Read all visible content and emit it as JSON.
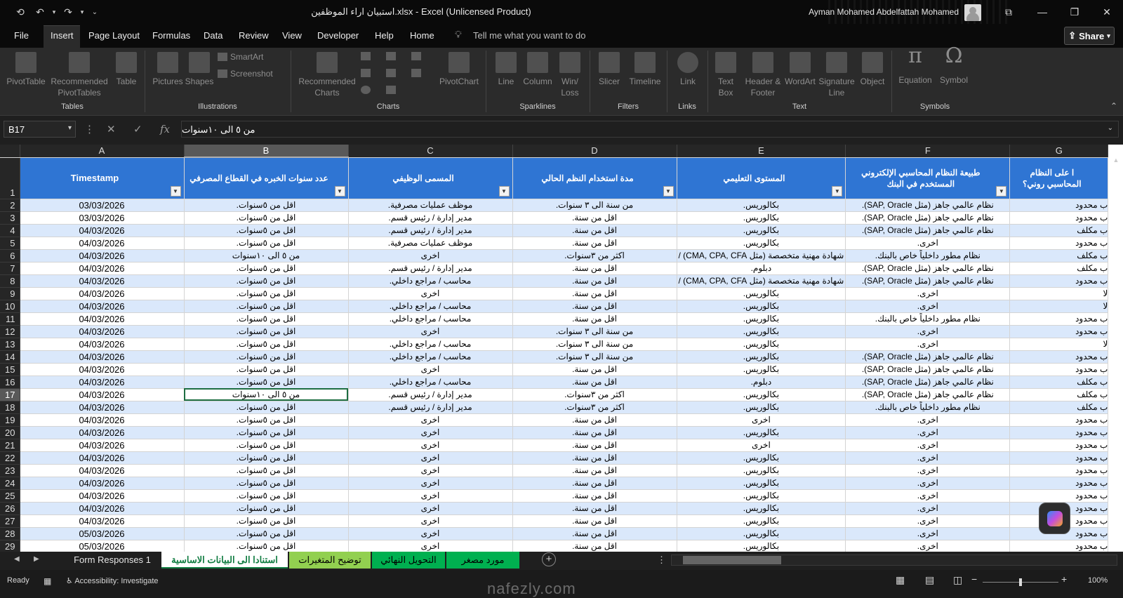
{
  "window": {
    "title": "استبيان اراء الموظفين.xlsx  -  Excel (Unlicensed Product)",
    "user": "Ayman Mohamed Abdelfattah Mohamed"
  },
  "menu": {
    "items": [
      "File",
      "Insert",
      "Page Layout",
      "Formulas",
      "Data",
      "Review",
      "View",
      "Developer",
      "Help",
      "Home"
    ],
    "tell_me": "Tell me what you want to do",
    "share": "Share"
  },
  "ribbon": {
    "tables": {
      "label": "Tables",
      "pivot": "PivotTable",
      "recommended": "Recommended PivotTables",
      "table": "Table"
    },
    "illustrations": {
      "label": "Illustrations",
      "pictures": "Pictures",
      "shapes": "Shapes",
      "smartart": "SmartArt",
      "screenshot": "Screenshot"
    },
    "charts": {
      "label": "Charts",
      "recommended": "Recommended Charts",
      "pivotchart": "PivotChart"
    },
    "sparklines": {
      "label": "Sparklines",
      "line": "Line",
      "column": "Column",
      "winloss": "Win/ Loss"
    },
    "filters": {
      "label": "Filters",
      "slicer": "Slicer",
      "timeline": "Timeline"
    },
    "links": {
      "label": "Links",
      "link": "Link"
    },
    "text": {
      "label": "Text",
      "textbox": "Text Box",
      "header": "Header & Footer",
      "wordart": "WordArt",
      "signature": "Signature Line",
      "object": "Object"
    },
    "symbols": {
      "label": "Symbols",
      "equation": "Equation",
      "symbol": "Symbol"
    }
  },
  "formula_bar": {
    "name_box": "B17",
    "value": "من ٥ الى ١٠سنوات"
  },
  "columns": [
    "A",
    "B",
    "C",
    "D",
    "E",
    "F",
    "G"
  ],
  "headers": {
    "A": "Timestamp",
    "B": "عدد سنوات الخبره في القطاع المصرفي",
    "C": "المسمى الوظيفي",
    "D": "مدة استخدام النظم الحالي",
    "E": "المستوى التعليمي",
    "F": "طبيعة النظام المحاسبي الإلكتروني المستخدم في البنك",
    "G": "ا على النظام المحاسبي روني؟"
  },
  "rows": [
    {
      "n": "2",
      "a": "03/03/2026",
      "b": "اقل من ٥سنوات.",
      "c": "موظف عمليات مصرفية.",
      "d": "من سنة الى ٣ سنوات.",
      "e": "بكالوريس.",
      "f": "نظام عالمي جاهز (مثل SAP, Oracle).",
      "g": "ب محدود"
    },
    {
      "n": "3",
      "a": "03/03/2026",
      "b": "اقل من ٥سنوات.",
      "c": "مدير إدارة / رئيس قسم.",
      "d": "اقل من سنة.",
      "e": "بكالوريس.",
      "f": "نظام عالمي جاهز (مثل SAP, Oracle).",
      "g": "ب محدود"
    },
    {
      "n": "4",
      "a": "04/03/2026",
      "b": "اقل من ٥سنوات.",
      "c": "مدير إدارة / رئيس قسم.",
      "d": "اقل من سنة.",
      "e": "بكالوريس.",
      "f": "نظام عالمي جاهز (مثل SAP, Oracle).",
      "g": "ب مكلف"
    },
    {
      "n": "5",
      "a": "04/03/2026",
      "b": "اقل من ٥سنوات.",
      "c": "موظف عمليات مصرفية.",
      "d": "اقل من سنة.",
      "e": "بكالوريس.",
      "f": "اخرى.",
      "g": "ب محدود"
    },
    {
      "n": "6",
      "a": "04/03/2026",
      "b": "من ٥ الى ١٠سنوات",
      "c": "اخرى",
      "d": "اكثر من ٣سنوات.",
      "e": "شهادة مهنية متخصصة (مثل CMA, CPA, CFA) /",
      "f": "نظام مطور داخلياً خاص بالبنك.",
      "g": "ب مكلف"
    },
    {
      "n": "7",
      "a": "04/03/2026",
      "b": "اقل من ٥سنوات.",
      "c": "مدير إدارة / رئيس قسم.",
      "d": "اقل من سنة.",
      "e": "دبلوم.",
      "f": "نظام عالمي جاهز (مثل SAP, Oracle).",
      "g": "ب مكلف"
    },
    {
      "n": "8",
      "a": "04/03/2026",
      "b": "اقل من ٥سنوات.",
      "c": "محاسب / مراجع داخلي.",
      "d": "اقل من سنة.",
      "e": "شهادة مهنية متخصصة (مثل CMA, CPA, CFA) /",
      "f": "نظام عالمي جاهز (مثل SAP, Oracle).",
      "g": "ب محدود"
    },
    {
      "n": "9",
      "a": "04/03/2026",
      "b": "اقل من ٥سنوات.",
      "c": "اخرى",
      "d": "اقل من سنة.",
      "e": "بكالوريس.",
      "f": "اخرى.",
      "g": "لا"
    },
    {
      "n": "10",
      "a": "04/03/2026",
      "b": "اقل من ٥سنوات.",
      "c": "محاسب / مراجع داخلي.",
      "d": "اقل من سنة.",
      "e": "بكالوريس.",
      "f": "اخرى.",
      "g": "لا"
    },
    {
      "n": "11",
      "a": "04/03/2026",
      "b": "اقل من ٥سنوات.",
      "c": "محاسب / مراجع داخلي.",
      "d": "اقل من سنة.",
      "e": "بكالوريس.",
      "f": "نظام مطور داخلياً خاص بالبنك.",
      "g": "ب محدود"
    },
    {
      "n": "12",
      "a": "04/03/2026",
      "b": "اقل من ٥سنوات.",
      "c": "اخرى",
      "d": "من سنة الى ٣ سنوات.",
      "e": "بكالوريس.",
      "f": "اخرى.",
      "g": "ب محدود"
    },
    {
      "n": "13",
      "a": "04/03/2026",
      "b": "اقل من ٥سنوات.",
      "c": "محاسب / مراجع داخلي.",
      "d": "من سنة الى ٣ سنوات.",
      "e": "بكالوريس.",
      "f": "اخرى.",
      "g": "لا"
    },
    {
      "n": "14",
      "a": "04/03/2026",
      "b": "اقل من ٥سنوات.",
      "c": "محاسب / مراجع داخلي.",
      "d": "من سنة الى ٣ سنوات.",
      "e": "بكالوريس.",
      "f": "نظام عالمي جاهز (مثل SAP, Oracle).",
      "g": "ب محدود"
    },
    {
      "n": "15",
      "a": "04/03/2026",
      "b": "اقل من ٥سنوات.",
      "c": "اخرى",
      "d": "اقل من سنة.",
      "e": "بكالوريس.",
      "f": "نظام عالمي جاهز (مثل SAP, Oracle).",
      "g": "ب محدود"
    },
    {
      "n": "16",
      "a": "04/03/2026",
      "b": "اقل من ٥سنوات.",
      "c": "محاسب / مراجع داخلي.",
      "d": "اقل من سنة.",
      "e": "دبلوم.",
      "f": "نظام عالمي جاهز (مثل SAP, Oracle).",
      "g": "ب مكلف"
    },
    {
      "n": "17",
      "a": "04/03/2026",
      "b": "من ٥ الى ١٠سنوات",
      "c": "مدير إدارة / رئيس قسم.",
      "d": "اكثر من ٣سنوات.",
      "e": "بكالوريس.",
      "f": "نظام عالمي جاهز (مثل SAP, Oracle).",
      "g": "ب مكلف"
    },
    {
      "n": "18",
      "a": "04/03/2026",
      "b": "اقل من ٥سنوات.",
      "c": "مدير إدارة / رئيس قسم.",
      "d": "اكثر من ٣سنوات.",
      "e": "بكالوريس.",
      "f": "نظام مطور داخلياً خاص بالبنك.",
      "g": "ب مكلف"
    },
    {
      "n": "19",
      "a": "04/03/2026",
      "b": "اقل من ٥سنوات.",
      "c": "اخرى",
      "d": "اقل من سنة.",
      "e": "اخرى",
      "f": "اخرى.",
      "g": "ب محدود"
    },
    {
      "n": "20",
      "a": "04/03/2026",
      "b": "اقل من ٥سنوات.",
      "c": "اخرى",
      "d": "اقل من سنة.",
      "e": "بكالوريس.",
      "f": "اخرى.",
      "g": "ب محدود"
    },
    {
      "n": "21",
      "a": "04/03/2026",
      "b": "اقل من ٥سنوات.",
      "c": "اخرى",
      "d": "اقل من سنة.",
      "e": "اخرى",
      "f": "اخرى.",
      "g": "ب محدود"
    },
    {
      "n": "22",
      "a": "04/03/2026",
      "b": "اقل من ٥سنوات.",
      "c": "اخرى",
      "d": "اقل من سنة.",
      "e": "بكالوريس.",
      "f": "اخرى.",
      "g": "ب محدود"
    },
    {
      "n": "23",
      "a": "04/03/2026",
      "b": "اقل من ٥سنوات.",
      "c": "اخرى",
      "d": "اقل من سنة.",
      "e": "بكالوريس.",
      "f": "اخرى.",
      "g": "ب محدود"
    },
    {
      "n": "24",
      "a": "04/03/2026",
      "b": "اقل من ٥سنوات.",
      "c": "اخرى",
      "d": "اقل من سنة.",
      "e": "بكالوريس.",
      "f": "اخرى.",
      "g": "ب محدود"
    },
    {
      "n": "25",
      "a": "04/03/2026",
      "b": "اقل من ٥سنوات.",
      "c": "اخرى",
      "d": "اقل من سنة.",
      "e": "بكالوريس.",
      "f": "اخرى.",
      "g": "ب محدود"
    },
    {
      "n": "26",
      "a": "04/03/2026",
      "b": "اقل من ٥سنوات.",
      "c": "اخرى",
      "d": "اقل من سنة.",
      "e": "بكالوريس.",
      "f": "اخرى.",
      "g": "ب محدود"
    },
    {
      "n": "27",
      "a": "04/03/2026",
      "b": "اقل من ٥سنوات.",
      "c": "اخرى",
      "d": "اقل من سنة.",
      "e": "بكالوريس.",
      "f": "اخرى.",
      "g": "ب محدود"
    },
    {
      "n": "28",
      "a": "05/03/2026",
      "b": "اقل من ٥سنوات.",
      "c": "اخرى",
      "d": "اقل من سنة.",
      "e": "بكالوريس.",
      "f": "اخرى.",
      "g": "ب محدود"
    },
    {
      "n": "29",
      "a": "05/03/2026",
      "b": "اقل من ٥سنوات.",
      "c": "اخرى",
      "d": "اقل من سنة.",
      "e": "بكالوريس.",
      "f": "اخرى.",
      "g": "ب محدود"
    }
  ],
  "sheet_tabs": [
    {
      "label": "Form Responses 1",
      "bg": "#1f1f1f",
      "fg": "#e6e6e6"
    },
    {
      "label": "استنادا الى البيانات الاساسية",
      "bg": "#ffffff",
      "fg": "#107c41"
    },
    {
      "label": "توضيح المتغيرات",
      "bg": "#92d050",
      "fg": "#000000"
    },
    {
      "label": "التحويل النهائي",
      "bg": "#00b050",
      "fg": "#000000"
    },
    {
      "label": "مورد مصغر",
      "bg": "#00b050",
      "fg": "#000000"
    }
  ],
  "status": {
    "ready": "Ready",
    "accessibility": "Accessibility: Investigate",
    "zoom": "100%"
  },
  "watermark": "nafezly.com"
}
